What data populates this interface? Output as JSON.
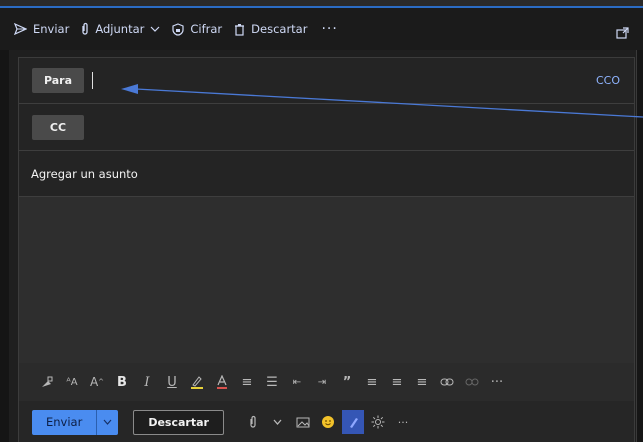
{
  "toolbar": {
    "send_label": "Enviar",
    "attach_label": "Adjuntar",
    "encrypt_label": "Cifrar",
    "discard_label": "Descartar",
    "more_glyph": "···"
  },
  "compose": {
    "to_label": "Para",
    "cc_label": "CC",
    "bcc_label": "CCO",
    "subject_placeholder": "Agregar un asunto"
  },
  "actions": {
    "send_label": "Enviar",
    "discard_label": "Descartar",
    "more_glyph": "···"
  },
  "format": {
    "bold_glyph": "B",
    "italic_glyph": "I",
    "underline_glyph": "U",
    "quote_glyph": "”",
    "more_glyph": "···"
  },
  "colors": {
    "accent": "#4a8cf0",
    "link": "#8fb4ff",
    "annotation_arrow": "#4a79d6"
  },
  "annotation": {
    "type": "arrow",
    "points_to": "to-field"
  }
}
